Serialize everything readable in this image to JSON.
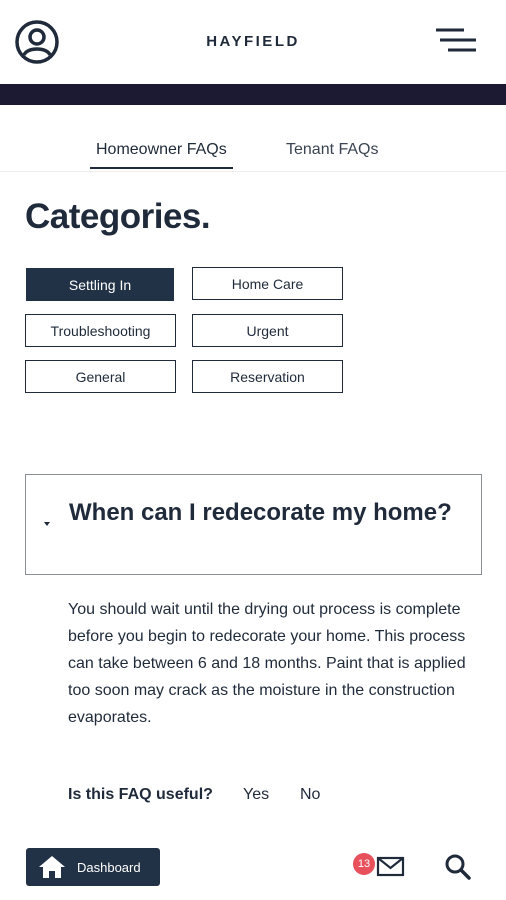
{
  "header": {
    "brand": "HAYFIELD",
    "user_icon": "user-circle-icon",
    "menu_icon": "menu-icon"
  },
  "tabs": [
    {
      "label": "Homeowner FAQs",
      "active": true
    },
    {
      "label": "Tenant FAQs",
      "active": false
    }
  ],
  "categories": {
    "title": "Categories.",
    "items": [
      {
        "label": "Settling In",
        "active": true
      },
      {
        "label": "Home Care",
        "active": false
      },
      {
        "label": "Troubleshooting",
        "active": false
      },
      {
        "label": "Urgent",
        "active": false
      },
      {
        "label": "General",
        "active": false
      },
      {
        "label": "Reservation",
        "active": false
      }
    ]
  },
  "faq": {
    "question": "When can I redecorate my home?",
    "answer": "You should wait until the drying out process is complete before you begin to redecorate your home.  This process can take between 6 and 18 months.  Paint that is applied too soon may crack as the moisture in the construction evaporates.",
    "useful_prompt": "Is this FAQ useful?",
    "yes_label": "Yes",
    "no_label": "No"
  },
  "bottom_bar": {
    "dashboard_label": "Dashboard",
    "dashboard_icon": "home-icon",
    "notification_count": "13",
    "mail_icon": "mail-icon",
    "search_icon": "search-icon"
  },
  "colors": {
    "primary": "#223246",
    "band": "#1c1a33",
    "badge": "#e8505b"
  }
}
